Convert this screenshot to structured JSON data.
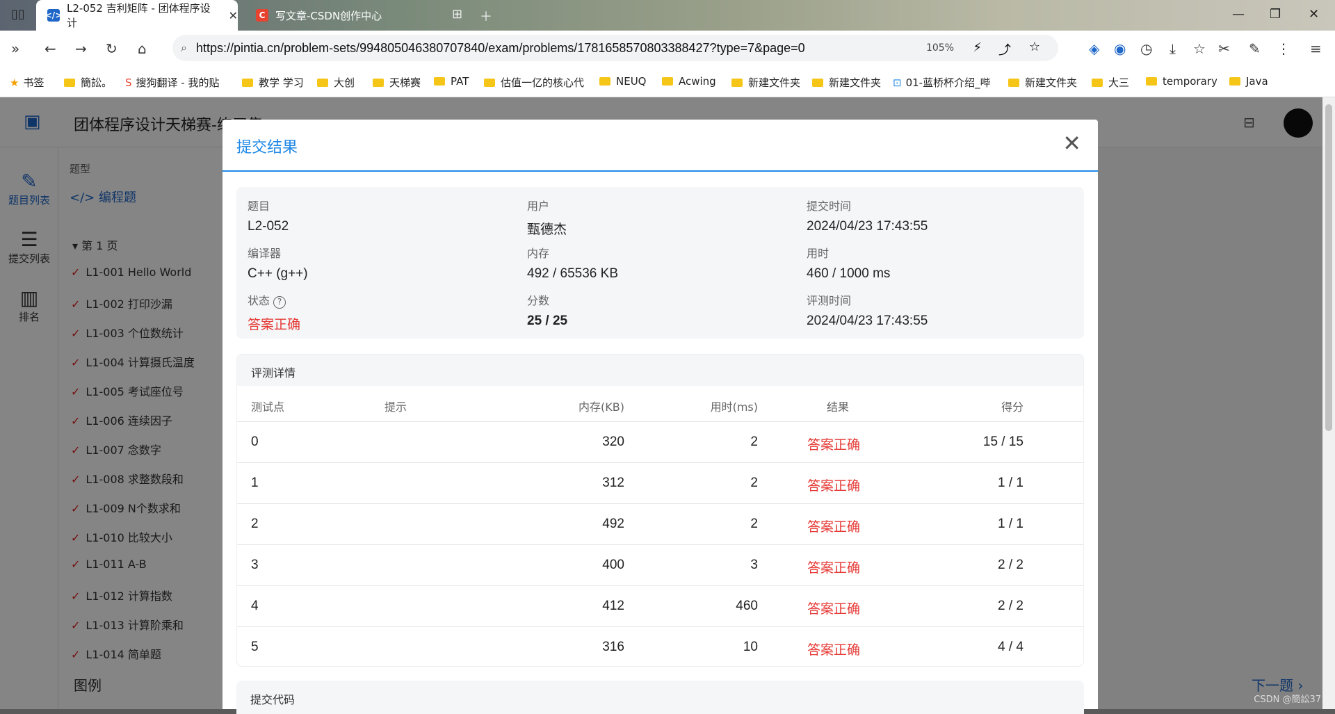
{
  "browser": {
    "tabs": [
      {
        "title": "L2-052 吉利矩阵 - 团体程序设计",
        "active": true
      },
      {
        "title": "写文章-CSDN创作中心",
        "active": false
      }
    ],
    "url": "https://pintia.cn/problem-sets/994805046380707840/exam/problems/1781658570803388427?type=7&page=0",
    "zoom": "105%",
    "bookmarks": [
      "书签",
      "簡訟。",
      "搜狗翻译 - 我的贴",
      "教学 学习",
      "大创",
      "天梯赛",
      "PAT",
      "估值一亿的核心代",
      "NEUQ",
      "Acwing",
      "新建文件夹",
      "新建文件夹",
      "01-蓝桥杯介绍_哔",
      "新建文件夹",
      "大三",
      "temporary",
      "Java"
    ]
  },
  "app": {
    "title": "团体程序设计天梯赛-练习集",
    "sidebar": [
      {
        "label": "题目列表",
        "icon": "edit-list-icon",
        "active": true
      },
      {
        "label": "提交列表",
        "icon": "list-icon",
        "active": false
      },
      {
        "label": "排名",
        "icon": "bar-chart-icon",
        "active": false
      }
    ],
    "list": {
      "type_header": "题型",
      "type_value": "编程题",
      "page_label": "第 1 页",
      "items": [
        "L1-001 Hello World",
        "L1-002 打印沙漏",
        "L1-003 个位数统计",
        "L1-004 计算摄氏温度",
        "L1-005 考试座位号",
        "L1-006 连续因子",
        "L1-007 念数字",
        "L1-008 求整数段和",
        "L1-009 N个数求和",
        "L1-010 比较大小",
        "L1-011 A-B",
        "L1-012 计算指数",
        "L1-013 计算阶乘和",
        "L1-014 简单题"
      ],
      "footer": "图例"
    },
    "next_label": "下一题"
  },
  "modal": {
    "title": "提交结果",
    "summary": {
      "problem_label": "题目",
      "problem": "L2-052",
      "user_label": "用户",
      "user": "甄德杰",
      "time_label": "提交时间",
      "time": "2024/04/23 17:43:55",
      "compiler_label": "编译器",
      "compiler": "C++ (g++)",
      "memory_label": "内存",
      "memory": "492 / 65536 KB",
      "duration_label": "用时",
      "duration": "460 / 1000 ms",
      "status_label": "状态",
      "status": "答案正确",
      "score_label": "分数",
      "score": "25 / 25",
      "judge_time_label": "评测时间",
      "judge_time": "2024/04/23 17:43:55"
    },
    "details": {
      "title": "评测详情",
      "columns": [
        "测试点",
        "提示",
        "内存(KB)",
        "用时(ms)",
        "结果",
        "得分"
      ],
      "rows": [
        {
          "point": "0",
          "hint": "",
          "memory": "320",
          "time": "2",
          "result": "答案正确",
          "score": "15 / 15"
        },
        {
          "point": "1",
          "hint": "",
          "memory": "312",
          "time": "2",
          "result": "答案正确",
          "score": "1 / 1"
        },
        {
          "point": "2",
          "hint": "",
          "memory": "492",
          "time": "2",
          "result": "答案正确",
          "score": "1 / 1"
        },
        {
          "point": "3",
          "hint": "",
          "memory": "400",
          "time": "3",
          "result": "答案正确",
          "score": "2 / 2"
        },
        {
          "point": "4",
          "hint": "",
          "memory": "412",
          "time": "460",
          "result": "答案正确",
          "score": "2 / 2"
        },
        {
          "point": "5",
          "hint": "",
          "memory": "316",
          "time": "10",
          "result": "答案正确",
          "score": "4 / 4"
        }
      ]
    },
    "submit_code_title": "提交代码"
  },
  "watermark": "CSDN @簡訟37"
}
